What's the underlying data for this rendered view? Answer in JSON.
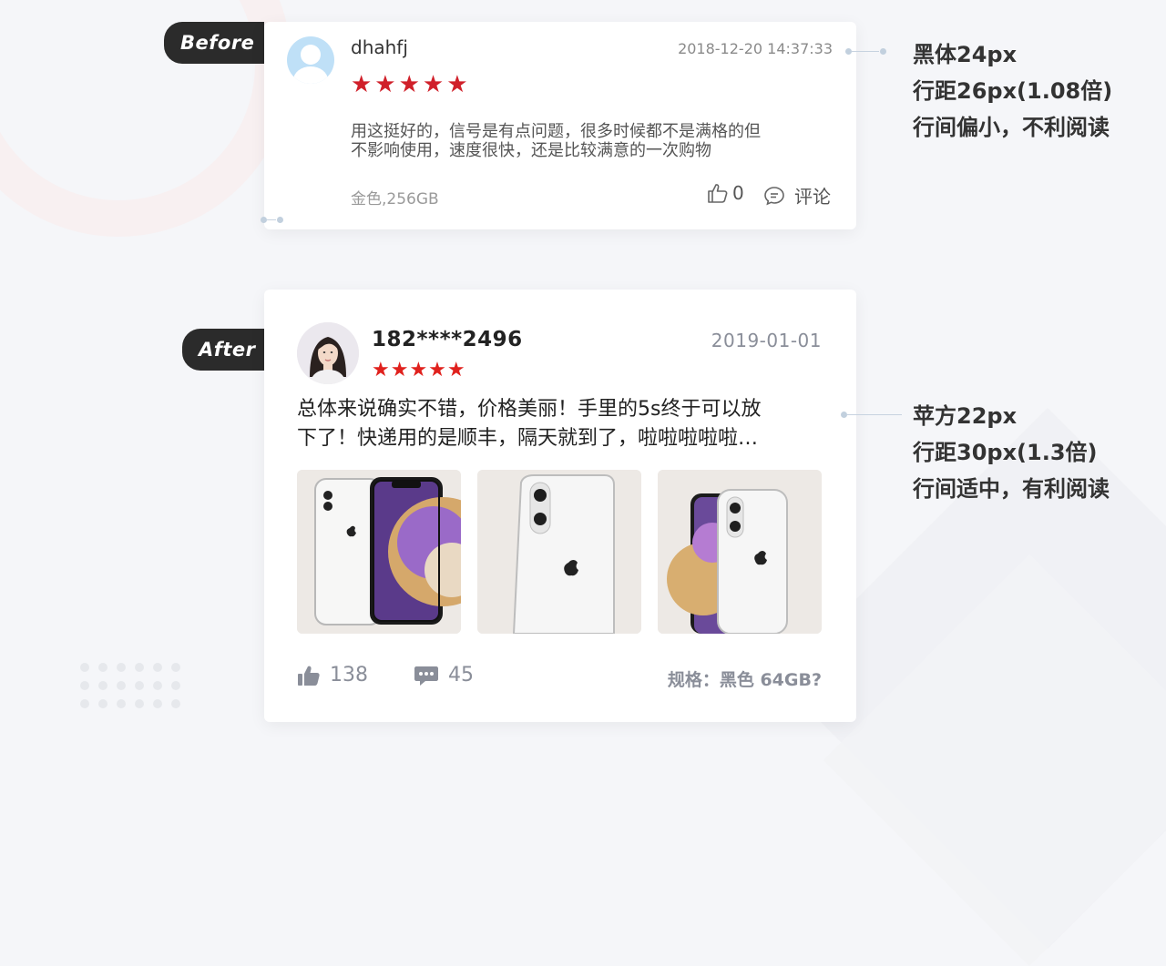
{
  "before": {
    "tag": "Before",
    "username": "dhahfj",
    "time": "2018-12-20 14:37:33",
    "stars": "★★★★★",
    "review_line1": "用这挺好的，信号是有点问题，很多时候都不是满格的但",
    "review_line2": "不影响使用，速度很快，还是比较满意的一次购物",
    "spec": "金色,256GB",
    "likes": "0",
    "comment_label": "评论"
  },
  "after": {
    "tag": "After",
    "username": "182****2496",
    "date": "2019-01-01",
    "stars": "★★★★★",
    "review_line1": "总体来说确实不错，价格美丽！手里的5s终于可以放",
    "review_line2": "下了！快递用的是顺丰，隔天就到了，啦啦啦啦啦…",
    "likes": "138",
    "comments": "45",
    "spec": "规格：黑色 64GB?"
  },
  "notes": {
    "before": [
      "黑体24px",
      "行距26px(1.08倍)",
      "行间偏小，不利阅读"
    ],
    "after": [
      "苹方22px",
      "行距30px(1.3倍)",
      "行间适中，有利阅读"
    ]
  },
  "colors": {
    "star_red": "#d0202a",
    "tag_bg": "#2b2b2b",
    "muted_text": "#8a8e99"
  }
}
